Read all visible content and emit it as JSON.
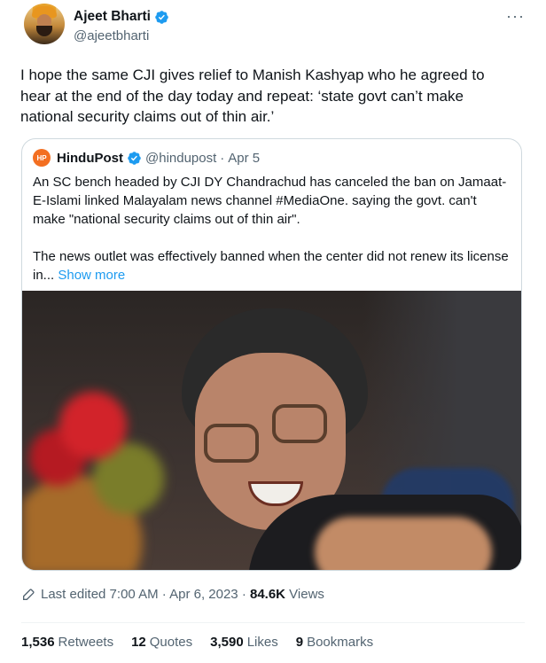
{
  "tweet": {
    "author_name": "Ajeet Bharti",
    "author_handle": "@ajeetbharti",
    "more_label": "···",
    "text": "I hope the same CJI gives relief to Manish Kashyap who he agreed to hear at the end of the day today and repeat: ‘state govt can’t make national security claims out of thin air.’"
  },
  "quote": {
    "logo_text": "HP",
    "author_name": "HinduPost",
    "author_handle": "@hindupost",
    "dot": "·",
    "date": "Apr 5",
    "paragraph1": "An SC bench headed by CJI DY Chandrachud has canceled the ban on Jamaat-E-Islami linked Malayalam news channel #MediaOne. saying the govt. can't make \"national security claims out of thin air\".",
    "paragraph2": "The news outlet was effectively banned when the center did not renew its license in... ",
    "show_more": "Show more"
  },
  "meta": {
    "edited_label": "Last edited 7:00 AM · Apr 6, 2023 · ",
    "views_count": "84.6K",
    "views_label": " Views"
  },
  "stats": {
    "retweets_count": "1,536",
    "retweets_label": "Retweets",
    "quotes_count": "12",
    "quotes_label": "Quotes",
    "likes_count": "3,590",
    "likes_label": "Likes",
    "bookmarks_count": "9",
    "bookmarks_label": "Bookmarks"
  },
  "colors": {
    "verified": "#1d9bf0",
    "link": "#1d9bf0",
    "secondary_text": "#536471",
    "primary_text": "#0f1419",
    "border": "#cfd9de",
    "hindupost_logo": "#f36f21"
  },
  "icons": [
    "verified-badge-icon",
    "more-icon",
    "pencil-icon"
  ]
}
